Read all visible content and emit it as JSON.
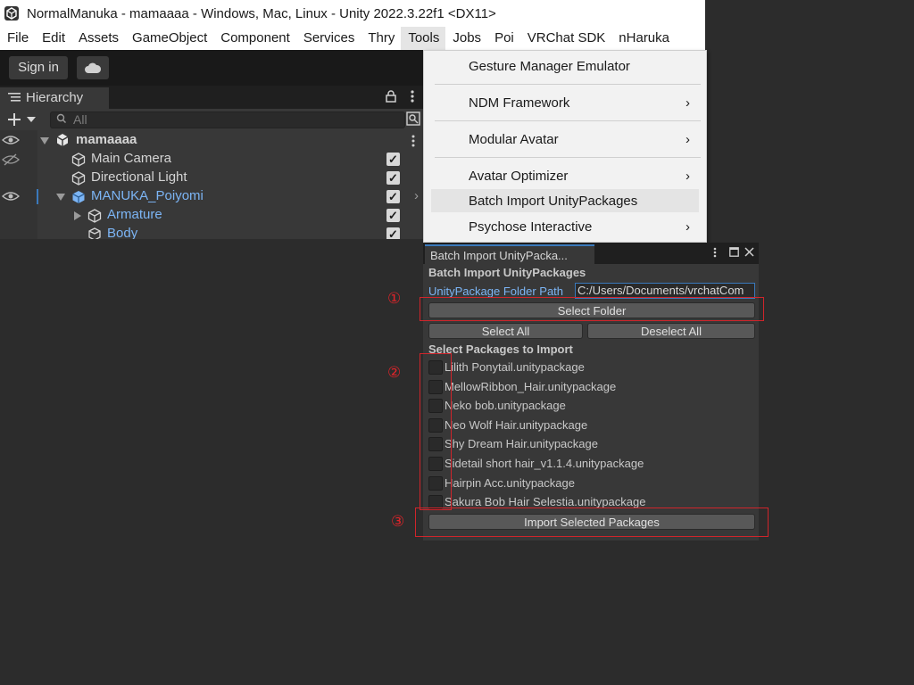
{
  "window": {
    "title": "NormalManuka - mamaaaa - Windows, Mac, Linux - Unity 2022.3.22f1 <DX11>"
  },
  "menubar": [
    "File",
    "Edit",
    "Assets",
    "GameObject",
    "Component",
    "Services",
    "Thry",
    "Tools",
    "Jobs",
    "Poi",
    "VRChat SDK",
    "nHaruka"
  ],
  "toolbar": {
    "sign_in": "Sign in"
  },
  "hierarchy": {
    "tab_label": "Hierarchy",
    "search_placeholder": "All",
    "rows": [
      {
        "label": "mamaaaa"
      },
      {
        "label": "Main Camera"
      },
      {
        "label": "Directional Light"
      },
      {
        "label": "MANUKA_Poiyomi"
      },
      {
        "label": "Armature"
      },
      {
        "label": "Body"
      }
    ]
  },
  "tools_menu": {
    "items": [
      {
        "label": "Gesture Manager Emulator",
        "submenu": false
      },
      {
        "label": "NDM Framework",
        "submenu": true
      },
      {
        "label": "Modular Avatar",
        "submenu": true
      },
      {
        "label": "Avatar Optimizer",
        "submenu": true
      },
      {
        "label": "Batch Import UnityPackages",
        "submenu": false
      },
      {
        "label": "Psychose Interactive",
        "submenu": true
      }
    ],
    "arrow": "›"
  },
  "batch_panel": {
    "tab_label": "Batch Import UnityPacka...",
    "heading": "Batch Import UnityPackages",
    "folder_path_label": "UnityPackage Folder Path",
    "folder_path_value": "C:/Users/Documents/vrchatCom",
    "select_folder": "Select Folder",
    "select_all": "Select All",
    "deselect_all": "Deselect All",
    "packages_heading": "Select Packages to Import",
    "packages": [
      "Lilith Ponytail.unitypackage",
      "MellowRibbon_Hair.unitypackage",
      "Neko bob.unitypackage",
      "Neo Wolf Hair.unitypackage",
      "Shy Dream Hair.unitypackage",
      "Sidetail short hair_v1.1.4.unitypackage",
      "Hairpin Acc.unitypackage",
      "Sakura Bob Hair Selestia.unitypackage"
    ],
    "import_button": "Import Selected Packages"
  },
  "annotations": {
    "marker1": "①",
    "marker2": "②",
    "marker3": "③"
  },
  "colors": {
    "accent_blue": "#7cb5f5",
    "annotation_red": "#d0252b"
  }
}
